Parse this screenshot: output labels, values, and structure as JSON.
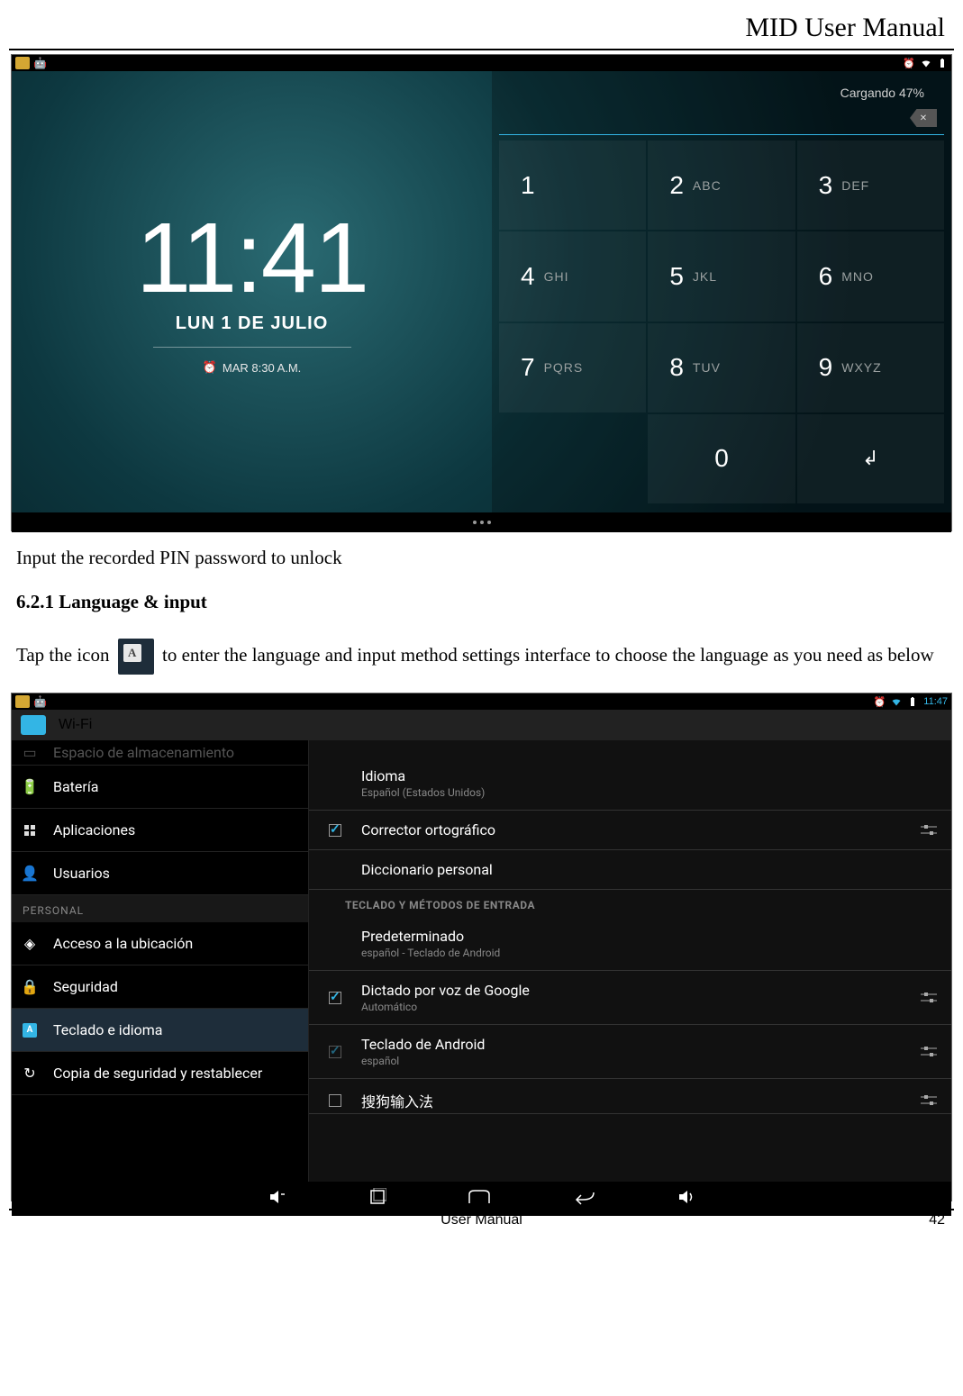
{
  "header": {
    "title": "MID User Manual"
  },
  "lockScreen": {
    "charging": "Cargando 47%",
    "time": "11:41",
    "dateLine": "LUN 1 DE JULIO",
    "alarm": "MAR 8:30 A.M.",
    "keys": [
      {
        "num": "1",
        "letters": ""
      },
      {
        "num": "2",
        "letters": "ABC"
      },
      {
        "num": "3",
        "letters": "DEF"
      },
      {
        "num": "4",
        "letters": "GHI"
      },
      {
        "num": "5",
        "letters": "JKL"
      },
      {
        "num": "6",
        "letters": "MNO"
      },
      {
        "num": "7",
        "letters": "PQRS"
      },
      {
        "num": "8",
        "letters": "TUV"
      },
      {
        "num": "9",
        "letters": "WXYZ"
      }
    ],
    "zero": "0"
  },
  "bodyText1": "Input the recorded PIN password to unlock",
  "sectionHeading": "6.2.1 Language & input",
  "bodyText2a": "Tap the icon ",
  "bodyText2b": " to enter the language and input method settings interface to choose the language as you need as below",
  "settings": {
    "statusTime": "11:47",
    "headerLabel": "Wi-Fi",
    "sidebar": {
      "cutoffTop": "Espacio de almacenamiento",
      "items": [
        {
          "icon": "battery-icon",
          "label": "Batería"
        },
        {
          "icon": "apps-icon",
          "label": "Aplicaciones"
        },
        {
          "icon": "users-icon",
          "label": "Usuarios"
        }
      ],
      "category": "PERSONAL",
      "items2": [
        {
          "icon": "location-icon",
          "label": "Acceso a la ubicación"
        },
        {
          "icon": "lock-icon",
          "label": "Seguridad"
        },
        {
          "icon": "keyboard-icon",
          "label": "Teclado e idioma",
          "selected": true
        },
        {
          "icon": "backup-icon",
          "label": "Copia de seguridad y restablecer"
        }
      ]
    },
    "right": {
      "rows": [
        {
          "title": "Idioma",
          "sub": "Español (Estados Unidos)",
          "leading": "none",
          "trailing": "none"
        },
        {
          "title": "Corrector ortográfico",
          "sub": "",
          "leading": "check-on",
          "trailing": "sliders"
        },
        {
          "title": "Diccionario personal",
          "sub": "",
          "leading": "none",
          "trailing": "none"
        }
      ],
      "sectionHeader": "TECLADO Y MÉTODOS DE ENTRADA",
      "rows2": [
        {
          "title": "Predeterminado",
          "sub": "español - Teclado de Android",
          "leading": "none",
          "trailing": "none"
        },
        {
          "title": "Dictado por voz de Google",
          "sub": "Automático",
          "leading": "check-on",
          "trailing": "sliders"
        },
        {
          "title": "Teclado de Android",
          "sub": "español",
          "leading": "check-dim",
          "trailing": "sliders"
        },
        {
          "title": "搜狗输入法",
          "sub": "",
          "leading": "check-off",
          "trailing": "sliders"
        }
      ]
    }
  },
  "footer": {
    "center": "User Manual",
    "pageNum": "42"
  }
}
